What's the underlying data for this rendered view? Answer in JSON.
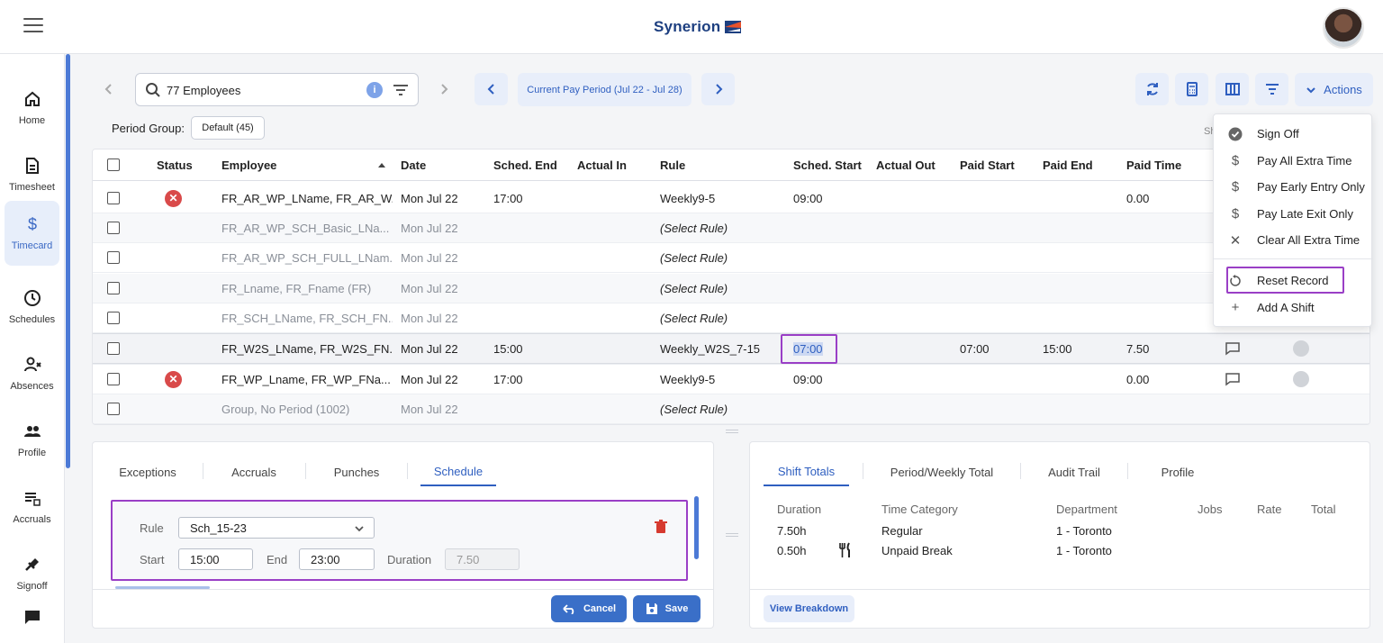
{
  "app": {
    "brand": "Synerion"
  },
  "sidebar": {
    "items": [
      {
        "label": "Home",
        "icon": "home-icon"
      },
      {
        "label": "Timesheet",
        "icon": "document-icon"
      },
      {
        "label": "Timecard",
        "icon": "dollar-icon",
        "active": true
      },
      {
        "label": "Schedules",
        "icon": "clock-icon"
      },
      {
        "label": "Absences",
        "icon": "person-x-icon"
      },
      {
        "label": "Profile",
        "icon": "people-icon"
      },
      {
        "label": "Accruals",
        "icon": "list-icon"
      },
      {
        "label": "Signoff",
        "icon": "signoff-icon"
      },
      {
        "label": "",
        "icon": "chat-icon"
      }
    ]
  },
  "toolbar": {
    "search_value": "77 Employees",
    "info_glyph": "i",
    "period_label": "Current Pay Period (Jul 22 - Jul 28)",
    "actions_label": "Actions",
    "period_group_label": "Period Group:",
    "period_group_value": "Default (45)",
    "show_label": "Sh"
  },
  "table": {
    "columns": [
      "Status",
      "Employee",
      "Date",
      "Sched. End",
      "Actual In",
      "Rule",
      "Sched. Start",
      "Actual Out",
      "Paid Start",
      "Paid End",
      "Paid Time"
    ],
    "rows": [
      {
        "status": "error",
        "employee": "FR_AR_WP_LName, FR_AR_W...",
        "date": "Mon Jul 22",
        "sched_end": "17:00",
        "actual_in": "",
        "rule": "Weekly9-5",
        "sched_start": "09:00",
        "actual_out": "",
        "paid_start": "",
        "paid_end": "",
        "paid_time": "0.00",
        "muted": false
      },
      {
        "status": "",
        "employee": "FR_AR_WP_SCH_Basic_LNa...",
        "date": "Mon Jul 22",
        "sched_end": "",
        "actual_in": "",
        "rule": "(Select Rule)",
        "sched_start": "",
        "actual_out": "",
        "paid_start": "",
        "paid_end": "",
        "paid_time": "",
        "muted": true
      },
      {
        "status": "",
        "employee": "FR_AR_WP_SCH_FULL_LNam...",
        "date": "Mon Jul 22",
        "sched_end": "",
        "actual_in": "",
        "rule": "(Select Rule)",
        "sched_start": "",
        "actual_out": "",
        "paid_start": "",
        "paid_end": "",
        "paid_time": "",
        "muted": true
      },
      {
        "status": "",
        "employee": "FR_Lname, FR_Fname (FR)",
        "date": "Mon Jul 22",
        "sched_end": "",
        "actual_in": "",
        "rule": "(Select Rule)",
        "sched_start": "",
        "actual_out": "",
        "paid_start": "",
        "paid_end": "",
        "paid_time": "",
        "muted": true
      },
      {
        "status": "",
        "employee": "FR_SCH_LName, FR_SCH_FN...",
        "date": "Mon Jul 22",
        "sched_end": "",
        "actual_in": "",
        "rule": "(Select Rule)",
        "sched_start": "",
        "actual_out": "",
        "paid_start": "",
        "paid_end": "",
        "paid_time": "",
        "muted": true
      },
      {
        "status": "",
        "employee": "FR_W2S_LName, FR_W2S_FN...",
        "date": "Mon Jul 22",
        "sched_end": "15:00",
        "actual_in": "",
        "rule": "Weekly_W2S_7-15",
        "sched_start": "07:00",
        "actual_out": "",
        "paid_start": "07:00",
        "paid_end": "15:00",
        "paid_time": "7.50",
        "muted": false
      },
      {
        "status": "error",
        "employee": "FR_WP_Lname, FR_WP_FNa...",
        "date": "Mon Jul 22",
        "sched_end": "17:00",
        "actual_in": "",
        "rule": "Weekly9-5",
        "sched_start": "09:00",
        "actual_out": "",
        "paid_start": "",
        "paid_end": "",
        "paid_time": "0.00",
        "muted": false
      },
      {
        "status": "",
        "employee": "Group, No Period (1002)",
        "date": "Mon Jul 22",
        "sched_end": "",
        "actual_in": "",
        "rule": "(Select Rule)",
        "sched_start": "",
        "actual_out": "",
        "paid_start": "",
        "paid_end": "",
        "paid_time": "",
        "muted": true
      }
    ]
  },
  "actions_menu": {
    "items": [
      {
        "label": "Sign Off",
        "icon": "check-circle-icon"
      },
      {
        "label": "Pay All Extra Time",
        "icon": "dollar-icon"
      },
      {
        "label": "Pay Early Entry Only",
        "icon": "dollar-icon"
      },
      {
        "label": "Pay Late Exit Only",
        "icon": "dollar-icon"
      },
      {
        "label": "Clear All Extra Time",
        "icon": "x-icon"
      },
      {
        "label": "Reset Record",
        "icon": "reset-icon"
      },
      {
        "label": "Add A Shift",
        "icon": "plus-icon"
      }
    ]
  },
  "left_panel": {
    "tabs": [
      "Exceptions",
      "Accruals",
      "Punches",
      "Schedule"
    ],
    "active_tab": "Schedule",
    "rule_label": "Rule",
    "rule_value": "Sch_15-23",
    "start_label": "Start",
    "start_value": "15:00",
    "end_label": "End",
    "end_value": "23:00",
    "duration_label": "Duration",
    "duration_value": "7.50",
    "cancel_label": "Cancel",
    "save_label": "Save"
  },
  "right_panel": {
    "tabs": [
      "Shift Totals",
      "Period/Weekly Total",
      "Audit Trail",
      "Profile"
    ],
    "active_tab": "Shift Totals",
    "columns": [
      "Duration",
      "Time Category",
      "Department",
      "Jobs",
      "Rate",
      "Total"
    ],
    "rows": [
      {
        "duration": "7.50h",
        "category": "Regular",
        "department": "1 - Toronto",
        "icon": ""
      },
      {
        "duration": "0.50h",
        "category": "Unpaid Break",
        "department": "1 - Toronto",
        "icon": "fork-knife-icon"
      }
    ],
    "breakdown_label": "View Breakdown"
  },
  "colors": {
    "accent": "#2f5fc0",
    "highlight": "#9a3fc6",
    "error": "#d94a4a"
  }
}
